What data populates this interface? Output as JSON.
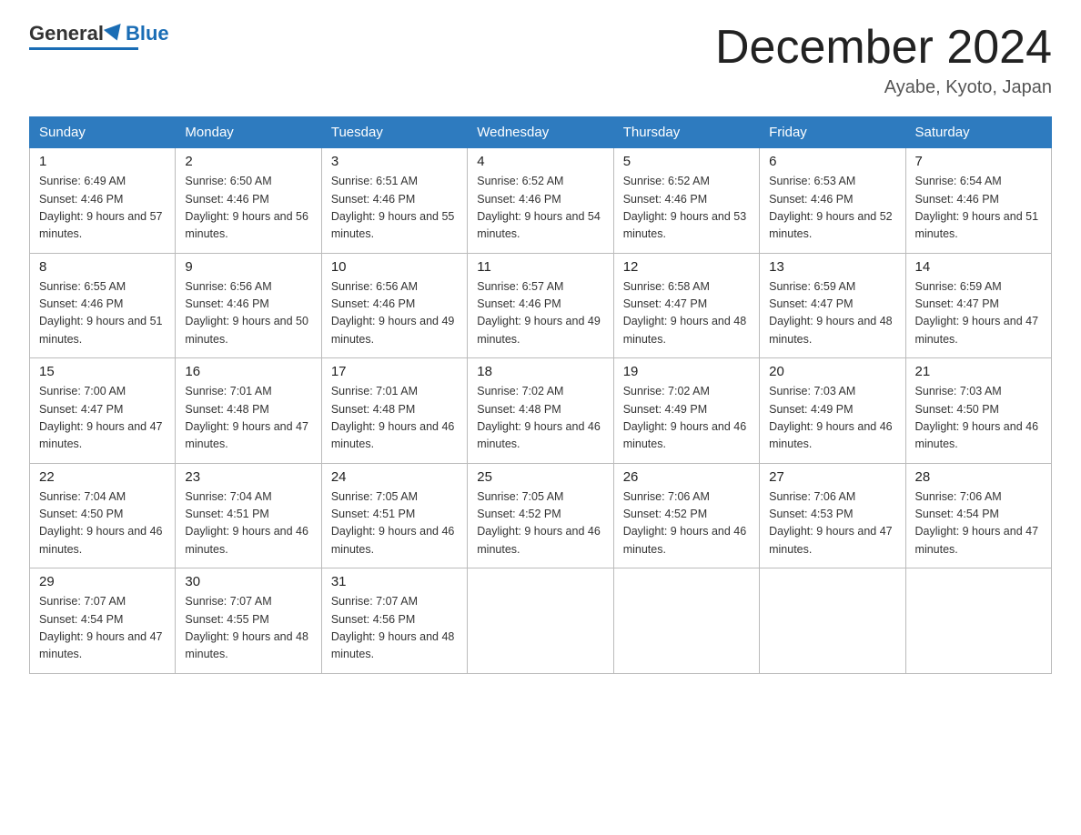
{
  "header": {
    "logo_general": "General",
    "logo_blue": "Blue",
    "month_title": "December 2024",
    "location": "Ayabe, Kyoto, Japan"
  },
  "weekdays": [
    "Sunday",
    "Monday",
    "Tuesday",
    "Wednesday",
    "Thursday",
    "Friday",
    "Saturday"
  ],
  "weeks": [
    [
      {
        "day": "1",
        "sunrise": "6:49 AM",
        "sunset": "4:46 PM",
        "daylight": "9 hours and 57 minutes."
      },
      {
        "day": "2",
        "sunrise": "6:50 AM",
        "sunset": "4:46 PM",
        "daylight": "9 hours and 56 minutes."
      },
      {
        "day": "3",
        "sunrise": "6:51 AM",
        "sunset": "4:46 PM",
        "daylight": "9 hours and 55 minutes."
      },
      {
        "day": "4",
        "sunrise": "6:52 AM",
        "sunset": "4:46 PM",
        "daylight": "9 hours and 54 minutes."
      },
      {
        "day": "5",
        "sunrise": "6:52 AM",
        "sunset": "4:46 PM",
        "daylight": "9 hours and 53 minutes."
      },
      {
        "day": "6",
        "sunrise": "6:53 AM",
        "sunset": "4:46 PM",
        "daylight": "9 hours and 52 minutes."
      },
      {
        "day": "7",
        "sunrise": "6:54 AM",
        "sunset": "4:46 PM",
        "daylight": "9 hours and 51 minutes."
      }
    ],
    [
      {
        "day": "8",
        "sunrise": "6:55 AM",
        "sunset": "4:46 PM",
        "daylight": "9 hours and 51 minutes."
      },
      {
        "day": "9",
        "sunrise": "6:56 AM",
        "sunset": "4:46 PM",
        "daylight": "9 hours and 50 minutes."
      },
      {
        "day": "10",
        "sunrise": "6:56 AM",
        "sunset": "4:46 PM",
        "daylight": "9 hours and 49 minutes."
      },
      {
        "day": "11",
        "sunrise": "6:57 AM",
        "sunset": "4:46 PM",
        "daylight": "9 hours and 49 minutes."
      },
      {
        "day": "12",
        "sunrise": "6:58 AM",
        "sunset": "4:47 PM",
        "daylight": "9 hours and 48 minutes."
      },
      {
        "day": "13",
        "sunrise": "6:59 AM",
        "sunset": "4:47 PM",
        "daylight": "9 hours and 48 minutes."
      },
      {
        "day": "14",
        "sunrise": "6:59 AM",
        "sunset": "4:47 PM",
        "daylight": "9 hours and 47 minutes."
      }
    ],
    [
      {
        "day": "15",
        "sunrise": "7:00 AM",
        "sunset": "4:47 PM",
        "daylight": "9 hours and 47 minutes."
      },
      {
        "day": "16",
        "sunrise": "7:01 AM",
        "sunset": "4:48 PM",
        "daylight": "9 hours and 47 minutes."
      },
      {
        "day": "17",
        "sunrise": "7:01 AM",
        "sunset": "4:48 PM",
        "daylight": "9 hours and 46 minutes."
      },
      {
        "day": "18",
        "sunrise": "7:02 AM",
        "sunset": "4:48 PM",
        "daylight": "9 hours and 46 minutes."
      },
      {
        "day": "19",
        "sunrise": "7:02 AM",
        "sunset": "4:49 PM",
        "daylight": "9 hours and 46 minutes."
      },
      {
        "day": "20",
        "sunrise": "7:03 AM",
        "sunset": "4:49 PM",
        "daylight": "9 hours and 46 minutes."
      },
      {
        "day": "21",
        "sunrise": "7:03 AM",
        "sunset": "4:50 PM",
        "daylight": "9 hours and 46 minutes."
      }
    ],
    [
      {
        "day": "22",
        "sunrise": "7:04 AM",
        "sunset": "4:50 PM",
        "daylight": "9 hours and 46 minutes."
      },
      {
        "day": "23",
        "sunrise": "7:04 AM",
        "sunset": "4:51 PM",
        "daylight": "9 hours and 46 minutes."
      },
      {
        "day": "24",
        "sunrise": "7:05 AM",
        "sunset": "4:51 PM",
        "daylight": "9 hours and 46 minutes."
      },
      {
        "day": "25",
        "sunrise": "7:05 AM",
        "sunset": "4:52 PM",
        "daylight": "9 hours and 46 minutes."
      },
      {
        "day": "26",
        "sunrise": "7:06 AM",
        "sunset": "4:52 PM",
        "daylight": "9 hours and 46 minutes."
      },
      {
        "day": "27",
        "sunrise": "7:06 AM",
        "sunset": "4:53 PM",
        "daylight": "9 hours and 47 minutes."
      },
      {
        "day": "28",
        "sunrise": "7:06 AM",
        "sunset": "4:54 PM",
        "daylight": "9 hours and 47 minutes."
      }
    ],
    [
      {
        "day": "29",
        "sunrise": "7:07 AM",
        "sunset": "4:54 PM",
        "daylight": "9 hours and 47 minutes."
      },
      {
        "day": "30",
        "sunrise": "7:07 AM",
        "sunset": "4:55 PM",
        "daylight": "9 hours and 48 minutes."
      },
      {
        "day": "31",
        "sunrise": "7:07 AM",
        "sunset": "4:56 PM",
        "daylight": "9 hours and 48 minutes."
      },
      null,
      null,
      null,
      null
    ]
  ]
}
